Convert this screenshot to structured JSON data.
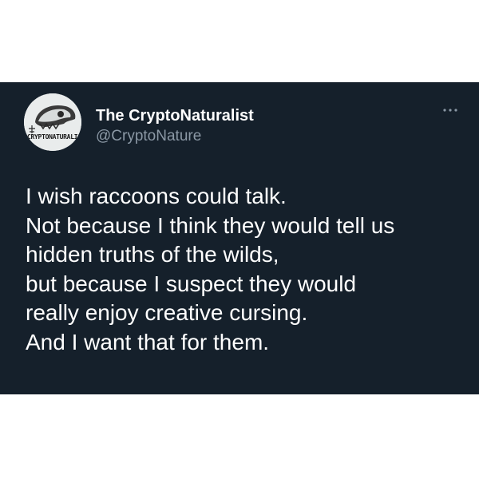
{
  "author": {
    "display_name": "The CryptoNaturalist",
    "handle": "@CryptoNature",
    "avatar_logo_text": "CRYPTONATURALIST"
  },
  "more_icon": "more-horizontal-icon",
  "tweet": {
    "lines": [
      "I wish raccoons could talk.",
      "Not because I think they would tell us",
      "hidden truths of the wilds,",
      "but because I suspect they would",
      "really enjoy creative cursing.",
      "And I want that for them."
    ]
  },
  "colors": {
    "card_background": "#15202b",
    "text_primary": "#ffffff",
    "text_secondary": "#8b98a5",
    "page_background": "#ffffff"
  }
}
